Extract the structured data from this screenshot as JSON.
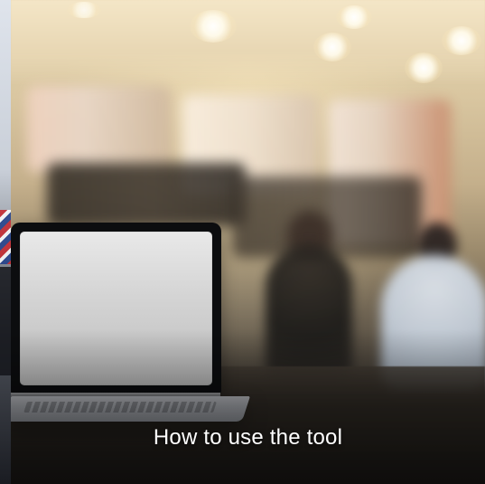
{
  "carousel": {
    "active_slide_title": "How to use the tool"
  },
  "colors": {
    "caption_text": "#ffffff"
  }
}
